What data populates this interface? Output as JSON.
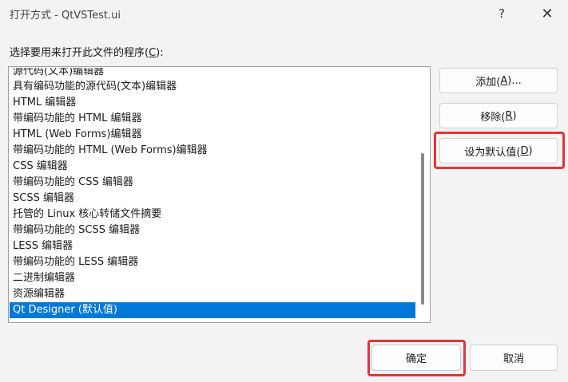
{
  "window": {
    "title": "打开方式 - QtVSTest.ui",
    "help_glyph": "?",
    "close_glyph": "✕"
  },
  "prompt": {
    "text": "选择要用来打开此文件的程序(",
    "accel": "C",
    "suffix": "):"
  },
  "programs": [
    "源代码(文本)编辑器",
    "具有编码功能的源代码(文本)编辑器",
    "HTML 编辑器",
    "带编码功能的 HTML 编辑器",
    "HTML (Web Forms)编辑器",
    "带编码功能的 HTML (Web Forms)编辑器",
    "CSS 编辑器",
    "带编码功能的 CSS 编辑器",
    "SCSS 编辑器",
    "托管的 Linux 核心转储文件摘要",
    "带编码功能的 SCSS 编辑器",
    "LESS 编辑器",
    "带编码功能的 LESS 编辑器",
    "二进制编辑器",
    "资源编辑器",
    "Qt Designer (默认值)"
  ],
  "selected_index": 15,
  "buttons": {
    "add": {
      "text": "添加(",
      "accel": "A",
      "suffix": ")..."
    },
    "remove": {
      "text": "移除(",
      "accel": "R",
      "suffix": ")"
    },
    "set_default": {
      "text": "设为默认值(",
      "accel": "D",
      "suffix": ")"
    },
    "ok": "确定",
    "cancel": "取消"
  },
  "colors": {
    "selection": "#0078d7",
    "highlight_box": "#e0363a"
  }
}
